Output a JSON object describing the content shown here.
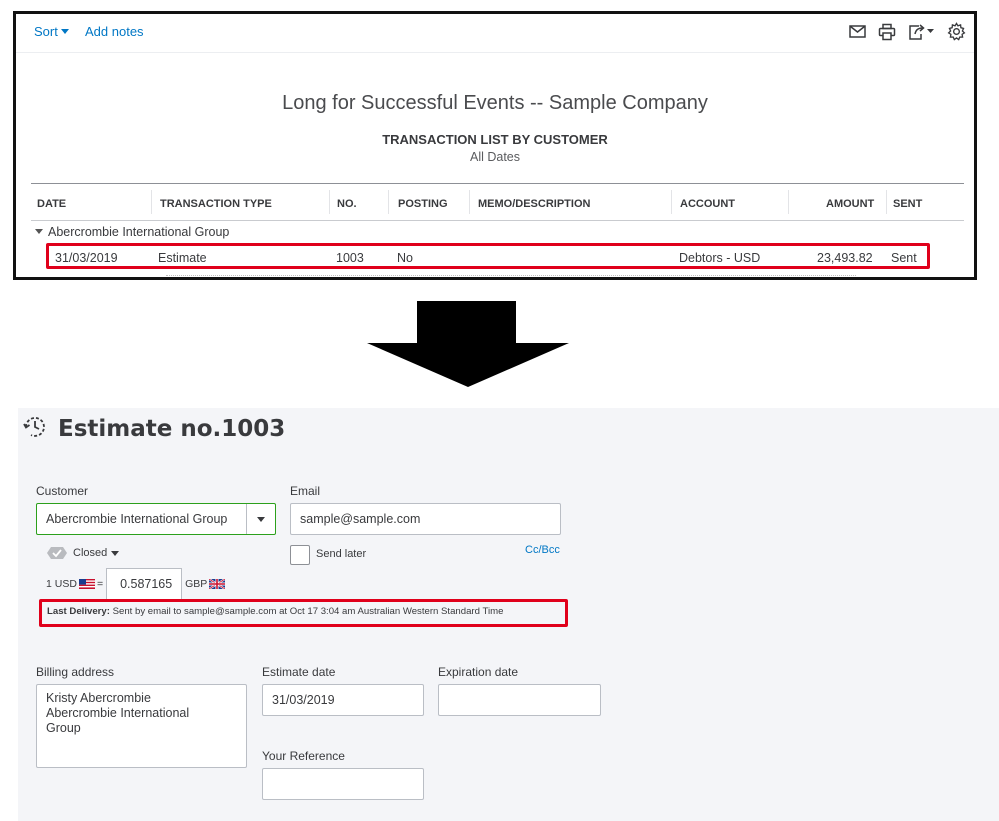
{
  "report": {
    "toolbar": {
      "sort_label": "Sort",
      "add_notes_label": "Add notes",
      "icons": [
        "email-icon",
        "print-icon",
        "export-icon",
        "settings-icon"
      ]
    },
    "company_name": "Long for Successful Events -- Sample Company",
    "title": "TRANSACTION LIST BY CUSTOMER",
    "subtitle": "All Dates",
    "columns": [
      "DATE",
      "TRANSACTION TYPE",
      "NO.",
      "POSTING",
      "MEMO/DESCRIPTION",
      "ACCOUNT",
      "AMOUNT",
      "SENT"
    ],
    "group_name": "Abercrombie International Group",
    "row": {
      "date": "31/03/2019",
      "type": "Estimate",
      "no": "1003",
      "posting": "No",
      "memo": "",
      "account": "Debtors - USD",
      "amount": "23,493.82",
      "sent": "Sent"
    },
    "highlight_color": "#e0001b"
  },
  "estimate": {
    "title": "Estimate no.1003",
    "customer": {
      "label": "Customer",
      "value": "Abercrombie International Group"
    },
    "email": {
      "label": "Email",
      "value": "sample@sample.com"
    },
    "status": "Closed",
    "send_later": {
      "label": "Send later",
      "checked": false
    },
    "cc_bcc": "Cc/Bcc",
    "exchange": {
      "left": "1 USD",
      "equals": "=",
      "rate": "0.587165",
      "right": "GBP"
    },
    "last_delivery": {
      "label": "Last Delivery:",
      "text": "Sent by email to sample@sample.com at Oct 17 3:04 am Australian Western Standard Time"
    },
    "billing": {
      "label": "Billing address",
      "lines": [
        "Kristy Abercrombie",
        "Abercrombie International",
        "Group"
      ]
    },
    "estimate_date": {
      "label": "Estimate date",
      "value": "31/03/2019"
    },
    "expiration_date": {
      "label": "Expiration date",
      "value": ""
    },
    "your_reference": {
      "label": "Your Reference",
      "value": ""
    },
    "accent_color": "#2ca01c",
    "link_color": "#0077c5"
  }
}
